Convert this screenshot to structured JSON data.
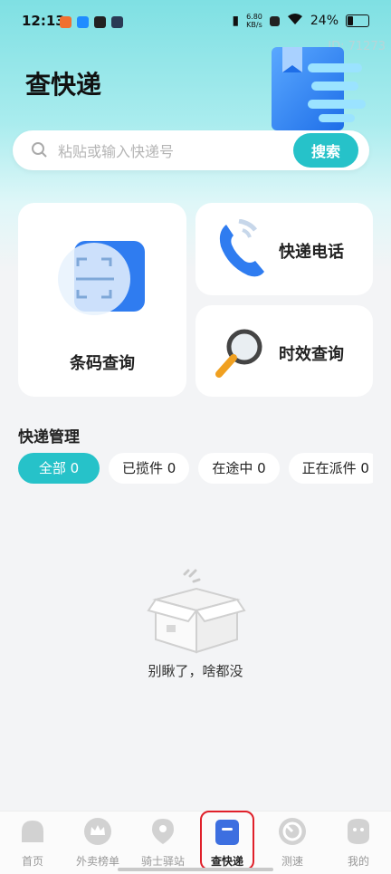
{
  "status_bar": {
    "time": "12:13",
    "speed_top": "6.80",
    "speed_bottom": "KB/s",
    "battery_text": "24%",
    "battery_level": 0.24
  },
  "watermark": "ID: 71273",
  "page": {
    "title": "查快递"
  },
  "search": {
    "placeholder": "粘贴或输入快递号",
    "button_label": "搜索"
  },
  "cards": {
    "barcode": "条码查询",
    "phone": "快递电话",
    "timeliness": "时效查询"
  },
  "management": {
    "title": "快递管理",
    "tabs": [
      {
        "label": "全部 0"
      },
      {
        "label": "已揽件 0"
      },
      {
        "label": "在途中 0"
      },
      {
        "label": "正在派件 0"
      }
    ],
    "active_tab": "全部 0"
  },
  "empty_state": {
    "text": "别瞅了，啥都没"
  },
  "bottom_nav": {
    "items": [
      {
        "label": "首页",
        "icon": "home-icon"
      },
      {
        "label": "外卖榜单",
        "icon": "crown-icon"
      },
      {
        "label": "骑士驿站",
        "icon": "location-pin-icon"
      },
      {
        "label": "查快递",
        "icon": "package-box-icon"
      },
      {
        "label": "测速",
        "icon": "speedometer-icon"
      },
      {
        "label": "我的",
        "icon": "profile-icon"
      }
    ],
    "active": "查快递"
  },
  "colors": {
    "accent": "#26c2c9",
    "highlight": "#e0202a",
    "active_nav": "#3d6fe0"
  }
}
